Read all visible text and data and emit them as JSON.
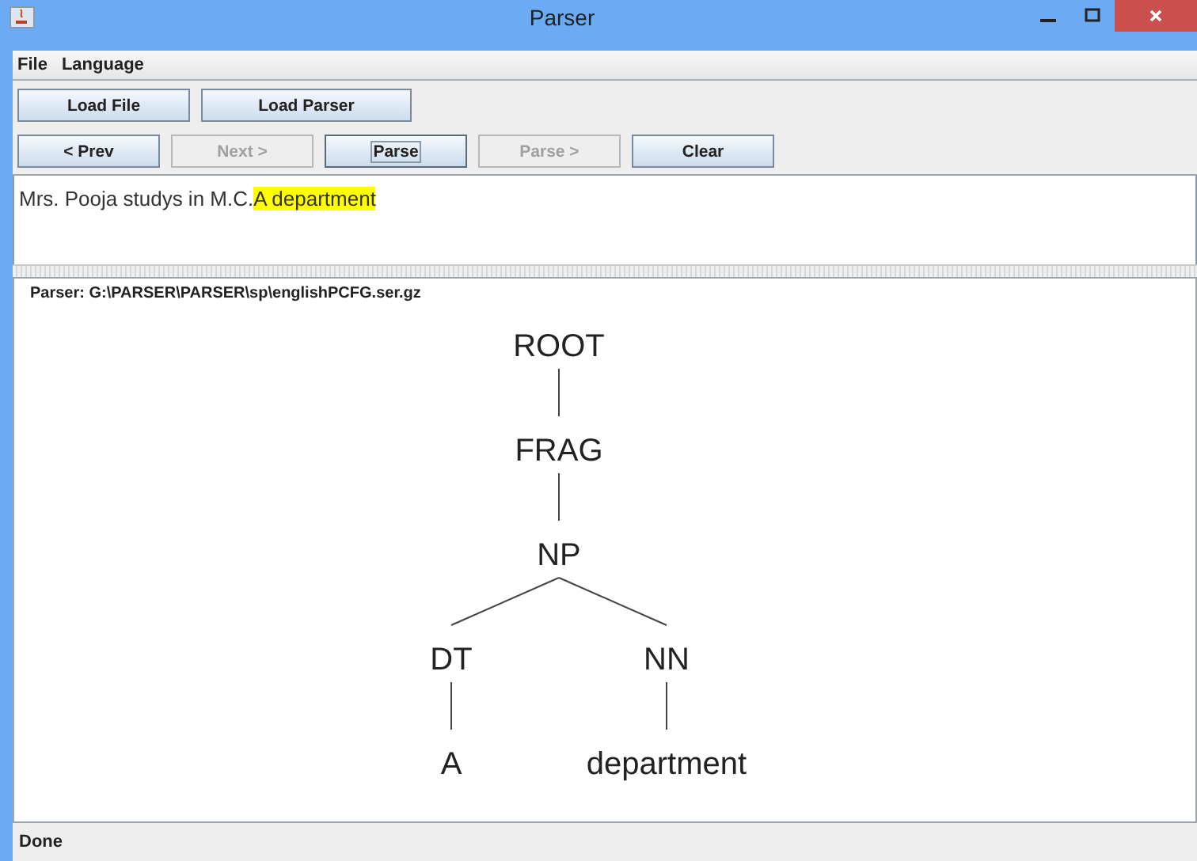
{
  "window": {
    "title": "Parser"
  },
  "menu": [
    "File",
    "Language"
  ],
  "toolbar_rows": [
    [
      {
        "label": "Load File",
        "disabled": false,
        "focused": false
      },
      {
        "label": "Load Parser",
        "disabled": false,
        "focused": false
      }
    ],
    [
      {
        "label": "< Prev",
        "disabled": false,
        "focused": false
      },
      {
        "label": "Next >",
        "disabled": true,
        "focused": false
      },
      {
        "label": "Parse",
        "disabled": false,
        "focused": true
      },
      {
        "label": "Parse >",
        "disabled": true,
        "focused": false
      },
      {
        "label": "Clear",
        "disabled": false,
        "focused": false
      }
    ]
  ],
  "input_text": {
    "plain": "Mrs. Pooja studys in M.C.",
    "highlighted": "A department"
  },
  "parser_label": "Parser: G:\\PARSER\\PARSER\\sp\\englishPCFG.ser.gz",
  "tree": {
    "label": "ROOT",
    "children": [
      {
        "label": "FRAG",
        "children": [
          {
            "label": "NP",
            "children": [
              {
                "label": "DT",
                "children": [
                  {
                    "label": "A"
                  }
                ]
              },
              {
                "label": "NN",
                "children": [
                  {
                    "label": "department"
                  }
                ]
              }
            ]
          }
        ]
      }
    ]
  },
  "status_bar": "Done"
}
